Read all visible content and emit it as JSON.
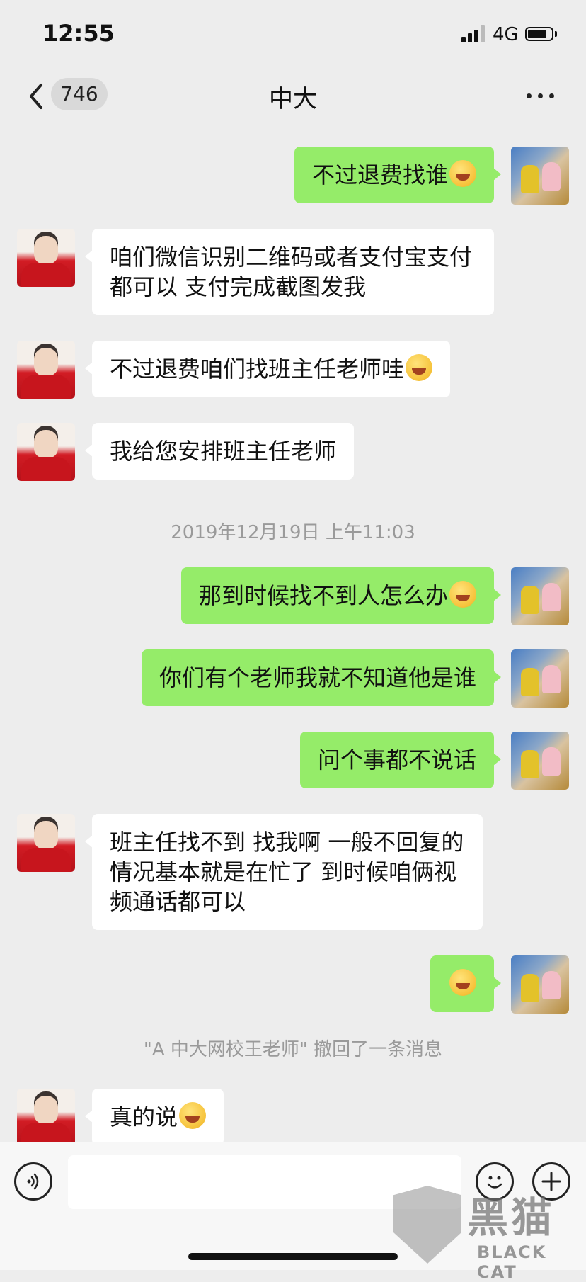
{
  "status_bar": {
    "time": "12:55",
    "network": "4G",
    "battery_fraction": 0.8
  },
  "nav": {
    "back_count": "746",
    "title": "中大"
  },
  "messages": [
    {
      "sender": "me",
      "text": "不过退费找谁",
      "emoji": "laughing-tears"
    },
    {
      "sender": "other",
      "text": "咱们微信识别二维码或者支付宝支付都可以 支付完成截图发我"
    },
    {
      "sender": "other",
      "text": "不过退费咱们找班主任老师哇",
      "emoji": "rolling-laughing"
    },
    {
      "sender": "other",
      "text": "我给您安排班主任老师"
    },
    {
      "type": "timestamp",
      "text": "2019年12月19日 上午11:03"
    },
    {
      "sender": "me",
      "text": "那到时候找不到人怎么办",
      "emoji": "rolling-laughing"
    },
    {
      "sender": "me",
      "text": "你们有个老师我就不知道他是谁"
    },
    {
      "sender": "me",
      "text": "问个事都不说话"
    },
    {
      "sender": "other",
      "text": "班主任找不到 找我啊 一般不回复的情况基本就是在忙了 到时候咱俩视频通话都可以"
    },
    {
      "sender": "me",
      "text": "",
      "emoji": "laughing-tears"
    },
    {
      "type": "system",
      "text": "\"A 中大网校王老师\" 撤回了一条消息"
    },
    {
      "sender": "other",
      "text": "真的说",
      "emoji": "smirk"
    }
  ],
  "input": {
    "placeholder": "",
    "value": ""
  },
  "watermark": {
    "text_cn": "黑猫",
    "text_en": "BLACK CAT"
  }
}
